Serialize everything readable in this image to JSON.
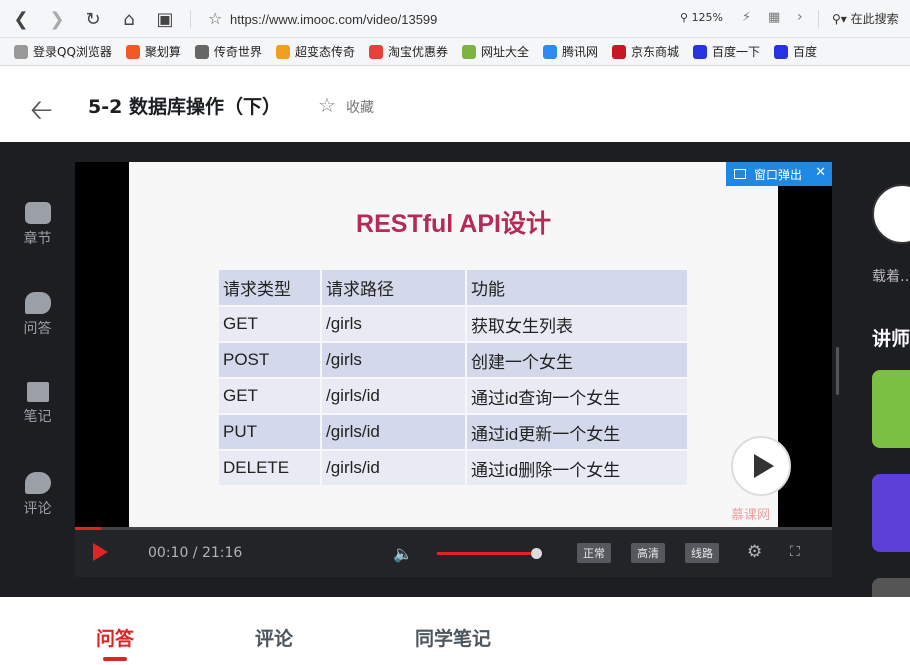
{
  "browser": {
    "url": "https://www.imooc.com/video/13599",
    "zoom": "125%",
    "search_label": "在此搜索",
    "bookmarks": [
      {
        "label": "登录QQ浏览器",
        "color": "#999999"
      },
      {
        "label": "聚划算",
        "color": "#f15a24"
      },
      {
        "label": "传奇世界",
        "color": "#666666"
      },
      {
        "label": "超变态传奇",
        "color": "#f0a020"
      },
      {
        "label": "淘宝优惠券",
        "color": "#e8413c"
      },
      {
        "label": "网址大全",
        "color": "#7cb342"
      },
      {
        "label": "腾讯网",
        "color": "#2d8cf0"
      },
      {
        "label": "京东商城",
        "color": "#c91623"
      },
      {
        "label": "百度一下",
        "color": "#2932e1"
      },
      {
        "label": "百度",
        "color": "#2932e1"
      }
    ]
  },
  "header": {
    "title": "5-2 数据库操作（下）",
    "favorite_label": "收藏"
  },
  "sidebar": {
    "items": [
      {
        "label": "章节",
        "icon": "chapters-icon"
      },
      {
        "label": "问答",
        "icon": "qa-icon"
      },
      {
        "label": "笔记",
        "icon": "note-icon"
      },
      {
        "label": "评论",
        "icon": "comment-icon"
      }
    ]
  },
  "player": {
    "popup_label": "窗口弹出",
    "slide_title": "RESTful API设计",
    "table": {
      "headers": [
        "请求类型",
        "请求路径",
        "功能"
      ],
      "rows": [
        [
          "GET",
          "/girls",
          "获取女生列表"
        ],
        [
          "POST",
          "/girls",
          "创建一个女生"
        ],
        [
          "GET",
          "/girls/id",
          "通过id查询一个女生"
        ],
        [
          "PUT",
          "/girls/id",
          "通过id更新一个女生"
        ],
        [
          "DELETE",
          "/girls/id",
          "通过id删除一个女生"
        ]
      ]
    },
    "watermark": "慕课网",
    "time": "00:10 / 21:16",
    "progress_fraction": 0.035,
    "volume_fraction": 0.97,
    "quality_buttons": [
      "正常",
      "高清",
      "线路"
    ]
  },
  "right_panel": {
    "teacher_name": "载着…",
    "section_label": "讲师"
  },
  "tabs": [
    {
      "label": "问答",
      "active": true
    },
    {
      "label": "评论",
      "active": false
    },
    {
      "label": "同学笔记",
      "active": false
    }
  ],
  "colors": {
    "accent": "#e02424",
    "slide_title": "#b52b55",
    "popup": "#1e88e5"
  }
}
